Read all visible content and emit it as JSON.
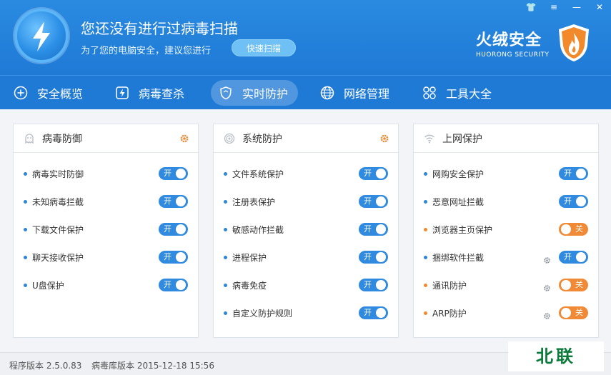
{
  "header": {
    "title": "您还没有进行过病毒扫描",
    "subtitle": "为了您的电脑安全，建议您进行",
    "quick_scan_label": "快速扫描",
    "brand_name": "火绒安全",
    "brand_en": "HUORONG SECURITY",
    "window_controls": {
      "skin": "👕",
      "menu": "≡",
      "minimize": "—",
      "close": "✕"
    }
  },
  "nav": {
    "items": [
      {
        "label": "安全概览",
        "icon": "plus-circle-icon"
      },
      {
        "label": "病毒查杀",
        "icon": "scan-bolt-icon"
      },
      {
        "label": "实时防护",
        "icon": "shield-icon",
        "active": true
      },
      {
        "label": "网络管理",
        "icon": "globe-icon"
      },
      {
        "label": "工具大全",
        "icon": "grid-icon"
      }
    ]
  },
  "panels": [
    {
      "title": "病毒防御",
      "icon": "ghost-icon",
      "rows": [
        {
          "label": "病毒实时防御",
          "toggle": "开",
          "state": "on"
        },
        {
          "label": "未知病毒拦截",
          "toggle": "开",
          "state": "on"
        },
        {
          "label": "下载文件保护",
          "toggle": "开",
          "state": "on"
        },
        {
          "label": "聊天接收保护",
          "toggle": "开",
          "state": "on"
        },
        {
          "label": "U盘保护",
          "toggle": "开",
          "state": "on"
        }
      ]
    },
    {
      "title": "系统防护",
      "icon": "fingerprint-icon",
      "rows": [
        {
          "label": "文件系统保护",
          "toggle": "开",
          "state": "on"
        },
        {
          "label": "注册表保护",
          "toggle": "开",
          "state": "on"
        },
        {
          "label": "敏感动作拦截",
          "toggle": "开",
          "state": "on"
        },
        {
          "label": "进程保护",
          "toggle": "开",
          "state": "on"
        },
        {
          "label": "病毒免疫",
          "toggle": "开",
          "state": "on"
        },
        {
          "label": "自定义防护规则",
          "toggle": "开",
          "state": "on"
        }
      ]
    },
    {
      "title": "上网保护",
      "icon": "wifi-icon",
      "rows": [
        {
          "label": "网购安全保护",
          "toggle": "开",
          "state": "on"
        },
        {
          "label": "恶意网址拦截",
          "toggle": "开",
          "state": "on"
        },
        {
          "label": "浏览器主页保护",
          "toggle": "关",
          "state": "off"
        },
        {
          "label": "捆绑软件拦截",
          "toggle": "开",
          "state": "on",
          "gear": true
        },
        {
          "label": "通讯防护",
          "toggle": "关",
          "state": "off",
          "gear": true
        },
        {
          "label": "ARP防护",
          "toggle": "关",
          "state": "off",
          "gear": true
        }
      ]
    }
  ],
  "footer": {
    "program_version": "程序版本 2.5.0.83",
    "virus_db_version": "病毒库版本 2015-12-18 15:56",
    "watermark": "北联"
  },
  "colors": {
    "accent": "#1f7ad6",
    "toggle_on": "#2f8ae0",
    "toggle_off": "#f08a36",
    "gear": "#f08a36"
  }
}
